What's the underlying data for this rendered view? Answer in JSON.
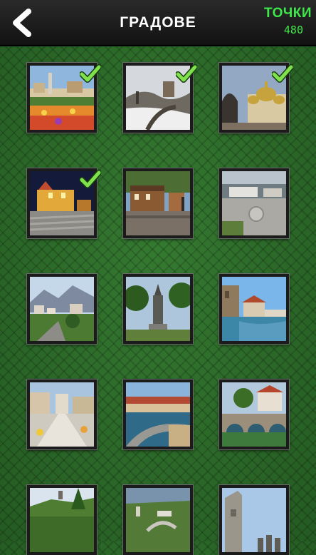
{
  "header": {
    "back_icon": "back-chevron-icon",
    "title": "ГРАДОВЕ",
    "points_label": "ТОЧКИ",
    "points_value": "480",
    "accent_color": "#3fe84a"
  },
  "cities": [
    {
      "id": "city-1",
      "solved": true
    },
    {
      "id": "city-2",
      "solved": true
    },
    {
      "id": "city-3",
      "solved": true
    },
    {
      "id": "city-4",
      "solved": true
    },
    {
      "id": "city-5",
      "solved": false
    },
    {
      "id": "city-6",
      "solved": false
    },
    {
      "id": "city-7",
      "solved": false
    },
    {
      "id": "city-8",
      "solved": false
    },
    {
      "id": "city-9",
      "solved": false
    },
    {
      "id": "city-10",
      "solved": false
    },
    {
      "id": "city-11",
      "solved": false
    },
    {
      "id": "city-12",
      "solved": false
    },
    {
      "id": "city-13",
      "solved": false
    },
    {
      "id": "city-14",
      "solved": false
    },
    {
      "id": "city-15",
      "solved": false
    }
  ]
}
